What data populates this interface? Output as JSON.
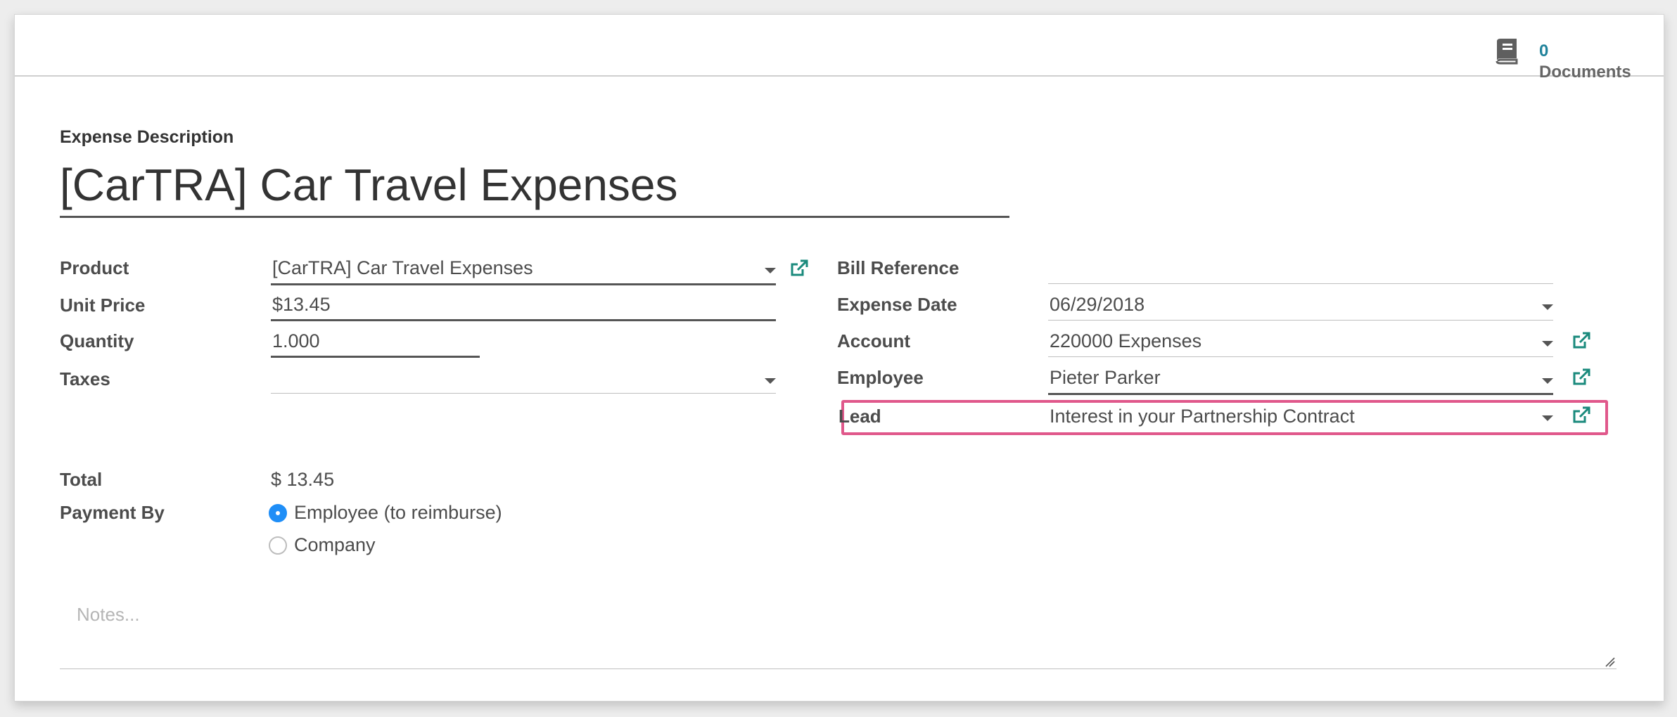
{
  "smart_button": {
    "count": "0",
    "label": "Documents"
  },
  "header": {
    "description_label": "Expense Description",
    "title": "[CarTRA] Car Travel Expenses"
  },
  "left": {
    "product": {
      "label": "Product",
      "value": "[CarTRA] Car Travel Expenses"
    },
    "unit_price": {
      "label": "Unit Price",
      "value": "$13.45"
    },
    "quantity": {
      "label": "Quantity",
      "value": "1.000"
    },
    "taxes": {
      "label": "Taxes",
      "value": ""
    },
    "total": {
      "label": "Total",
      "value": "$ 13.45"
    },
    "payment_by": {
      "label": "Payment By",
      "options": [
        "Employee (to reimburse)",
        "Company"
      ],
      "selected": "Employee (to reimburse)"
    }
  },
  "right": {
    "bill_reference": {
      "label": "Bill Reference",
      "value": ""
    },
    "expense_date": {
      "label": "Expense Date",
      "value": "06/29/2018"
    },
    "account": {
      "label": "Account",
      "value": "220000 Expenses"
    },
    "employee": {
      "label": "Employee",
      "value": "Pieter Parker"
    },
    "lead": {
      "label": "Lead",
      "value": "Interest in your Partnership Contract"
    }
  },
  "notes": {
    "placeholder": "Notes..."
  },
  "colors": {
    "accent": "#21839b",
    "link_icon": "#1a8a7c",
    "radio_selected": "#1f8ef7",
    "highlight": "#e0588b"
  },
  "icons": {
    "documents": "book-icon",
    "external_link": "external-link-icon",
    "dropdown": "caret-down-icon"
  }
}
